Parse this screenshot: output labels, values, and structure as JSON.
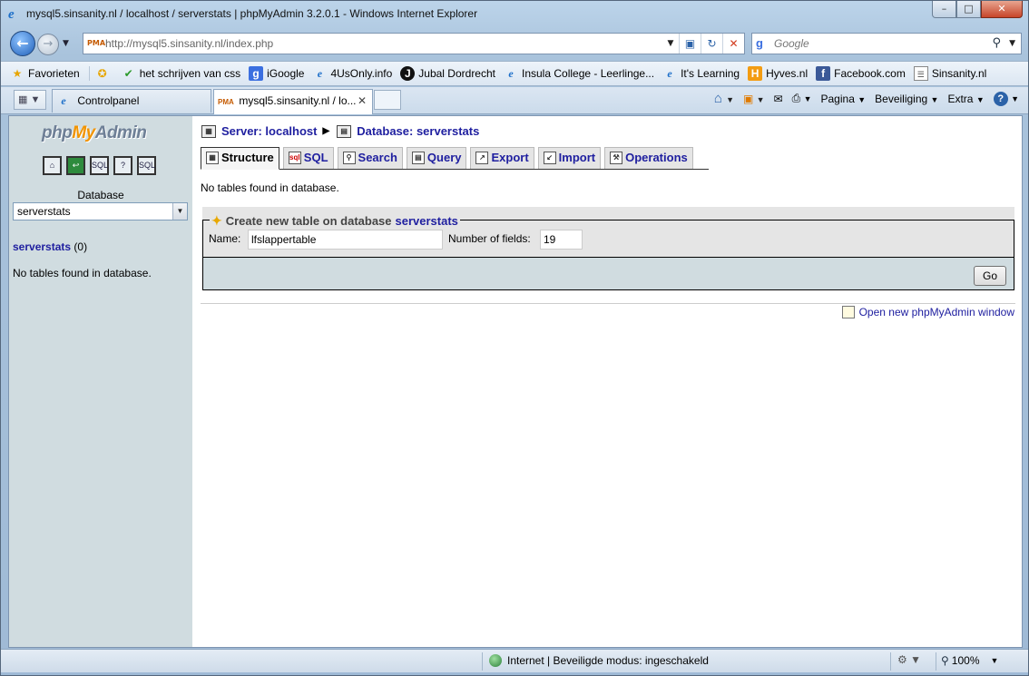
{
  "window": {
    "title": "mysql5.sinsanity.nl / localhost / serverstats | phpMyAdmin 3.2.0.1 - Windows Internet Explorer",
    "min_label": "–",
    "max_label": "□",
    "close_label": "✕"
  },
  "address_bar": {
    "url": "http://mysql5.sinsanity.nl/index.php",
    "search_placeholder": "Google"
  },
  "favorites_bar": {
    "favorites_label": "Favorieten",
    "items": [
      {
        "label": "het schrijven van css",
        "icon": "green-check-icon"
      },
      {
        "label": "iGoogle",
        "icon": "google-icon"
      },
      {
        "label": "4UsOnly.info",
        "icon": "ie-page-icon"
      },
      {
        "label": "Jubal Dordrecht",
        "icon": "jd-icon"
      },
      {
        "label": "Insula College - Leerlinge...",
        "icon": "ie-page-icon"
      },
      {
        "label": "It's Learning",
        "icon": "ie-page-icon"
      },
      {
        "label": "Hyves.nl",
        "icon": "hyves-icon"
      },
      {
        "label": "Facebook.com",
        "icon": "facebook-icon"
      },
      {
        "label": "Sinsanity.nl",
        "icon": "page-icon"
      }
    ]
  },
  "tabs": [
    {
      "label": "Controlpanel",
      "active": false
    },
    {
      "label": "mysql5.sinsanity.nl / lo...",
      "active": true
    }
  ],
  "command_bar": {
    "page_label": "Pagina",
    "security_label": "Beveiliging",
    "extra_label": "Extra",
    "help_label": "?"
  },
  "left_frame": {
    "logo_php": "php",
    "logo_my": "My",
    "logo_admin": "Admin",
    "database_label": "Database",
    "selected_db": "serverstats",
    "db_link": "serverstats",
    "db_count": "(0)",
    "no_tables": "No tables found in database."
  },
  "right_frame": {
    "crumb_server": "Server: localhost",
    "crumb_database": "Database: serverstats",
    "tabs": [
      "Structure",
      "SQL",
      "Search",
      "Query",
      "Export",
      "Import",
      "Operations"
    ],
    "active_tab": "Structure",
    "message": "No tables found in database.",
    "create_legend": "Create new table on database",
    "create_db": "serverstats",
    "name_label": "Name:",
    "name_value": "lfslappertable",
    "fields_label": "Number of fields:",
    "fields_value": "19",
    "go_label": "Go",
    "open_new_window": "Open new phpMyAdmin window"
  },
  "status_bar": {
    "zone_text": "Internet | Beveiligde modus: ingeschakeld",
    "zoom": "100%"
  },
  "colors": {
    "link": "#2020a0",
    "left_frame_bg": "#d0dce0",
    "fieldset_bg": "#e5e5e5"
  }
}
